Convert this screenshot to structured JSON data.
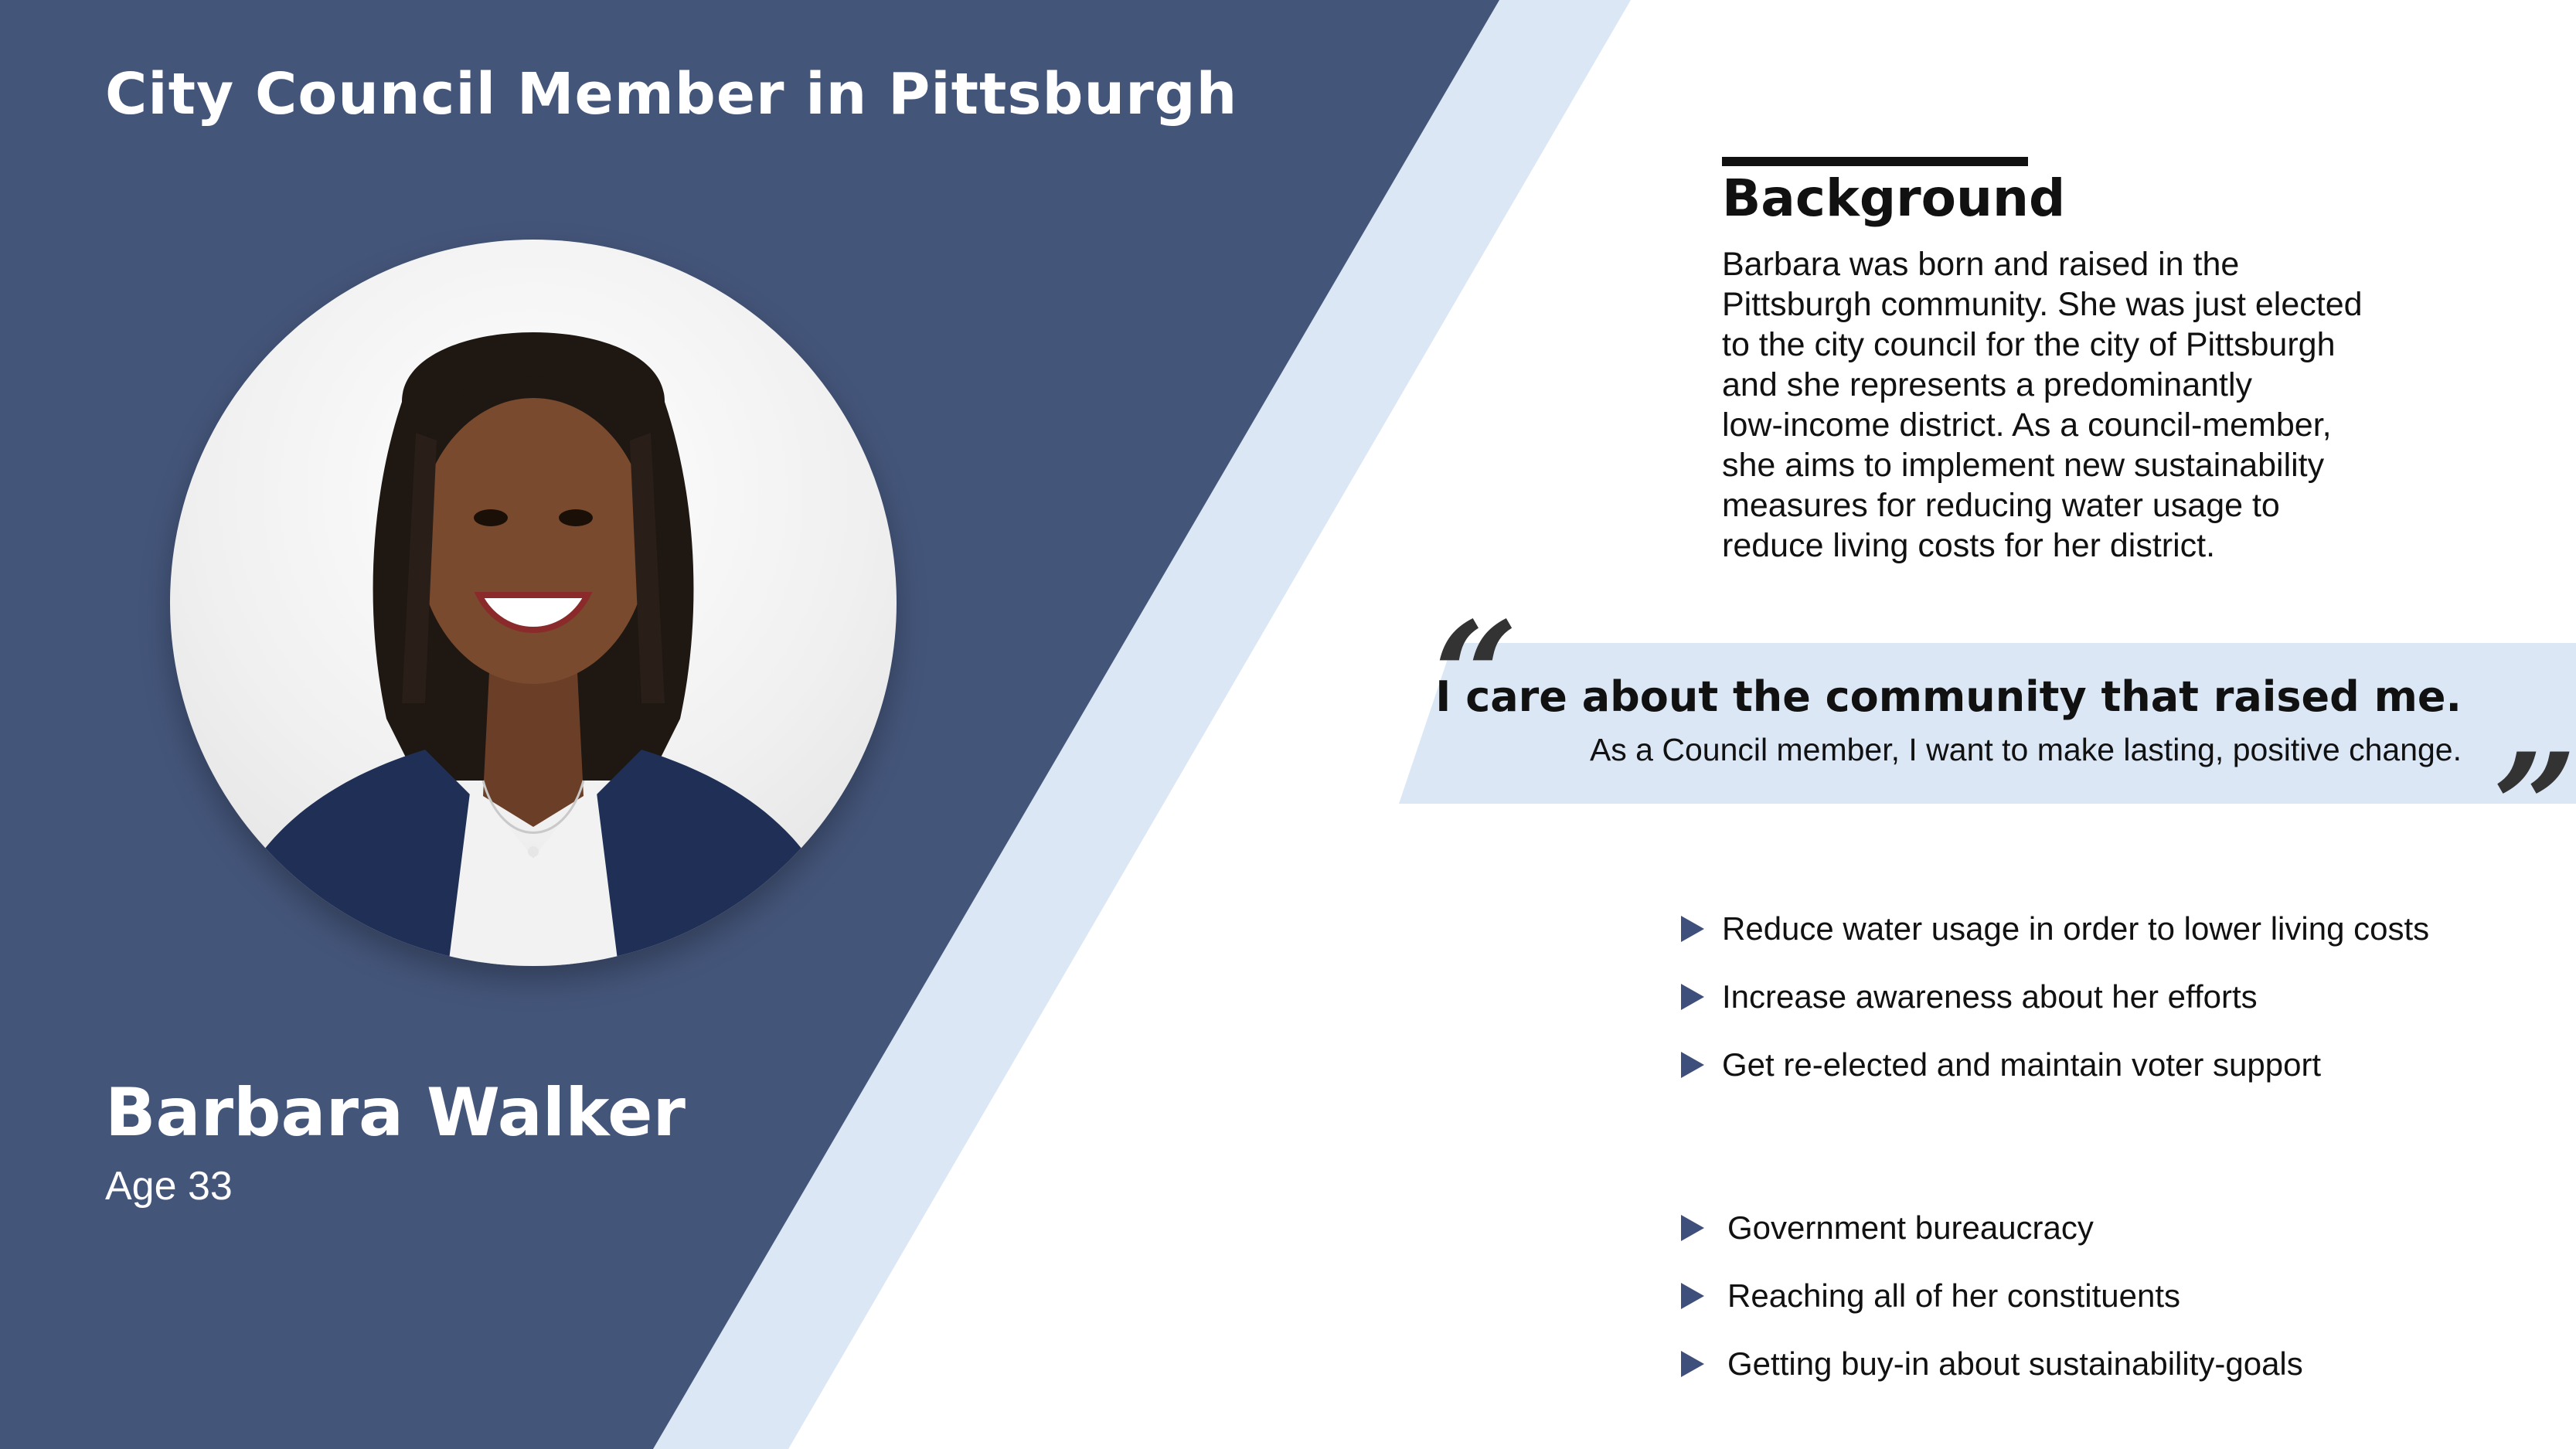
{
  "persona": {
    "title": "City Council Member in Pittsburgh",
    "name": "Barbara Walker",
    "age_label": "Age 33"
  },
  "background": {
    "heading": "Background",
    "lines": [
      "Barbara was born and raised in the",
      "Pittsburgh community. She was just elected",
      "to the city council for the city of Pittsburgh",
      "and she represents a predominantly",
      "low-income district. As a council-member,",
      "she aims to implement new sustainability",
      "measures for reducing water usage to",
      "reduce living costs for her district."
    ]
  },
  "quote": {
    "open_mark": "“",
    "close_mark": "”",
    "main": "I care about the community that raised me.",
    "sub": "As a Council member, I want to make lasting, positive change."
  },
  "goals": [
    "Reduce water usage in order to lower living costs",
    "Increase awareness about her efforts",
    "Get re-elected and maintain voter support"
  ],
  "pain_points": [
    "Government bureaucracy",
    "Reaching all of her constituents",
    "Getting buy-in about sustainability-goals"
  ],
  "icons": {
    "bullet": "triangle-bullet-icon",
    "portrait": "persona-photo"
  },
  "colors": {
    "navy_panel": "#44557a",
    "light_blue_stripe": "#dbe7f5",
    "bullet": "#3d4f7a",
    "text_dark": "#111111",
    "text_light": "#ffffff"
  }
}
